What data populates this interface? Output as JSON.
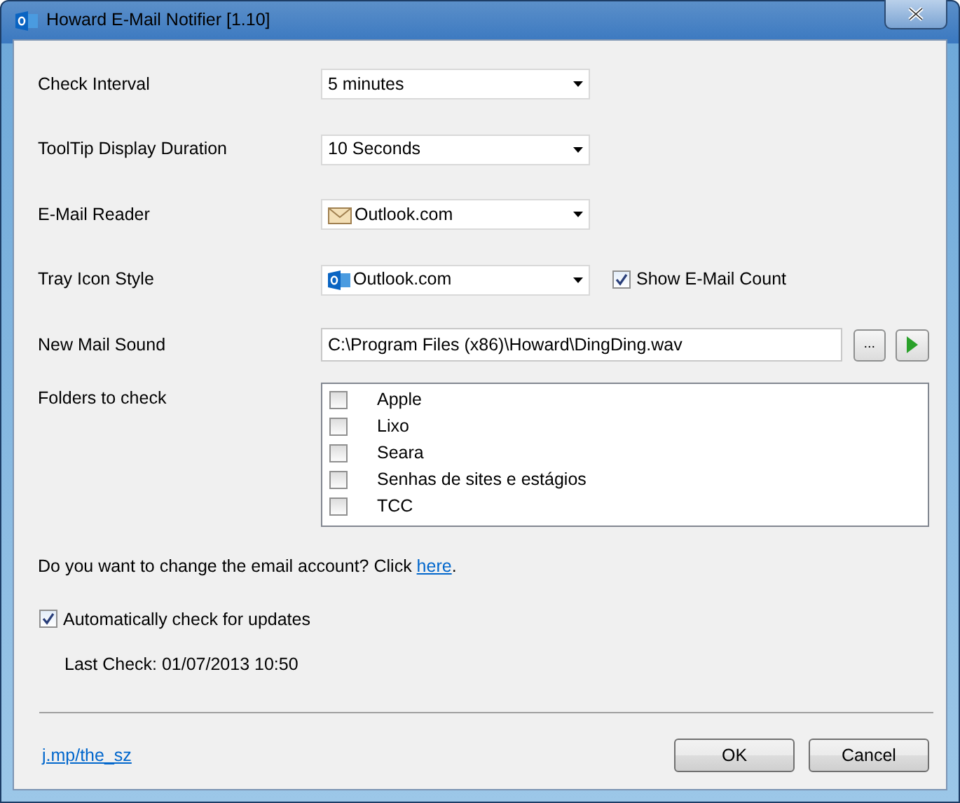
{
  "window": {
    "title": "Howard E-Mail Notifier [1.10]"
  },
  "settings": [
    {
      "kind": "dropdown",
      "label": "Check Interval",
      "value": "5 minutes"
    },
    {
      "kind": "dropdown",
      "label": "ToolTip Display Duration",
      "value": "10 Seconds"
    },
    {
      "kind": "dropdown",
      "label": "E-Mail Reader",
      "value": "Outlook.com"
    },
    {
      "kind": "dropdown",
      "label": "Tray Icon Style",
      "value": "Outlook.com",
      "checkbox": {
        "label": "Show E-Mail Count",
        "checked": true
      }
    },
    {
      "kind": "file",
      "label": "New Mail Sound",
      "value": "C:\\Program Files (x86)\\Howard\\DingDing.wav",
      "browse": "..."
    }
  ],
  "folders": {
    "label": "Folders to check",
    "items": [
      {
        "name": "Apple",
        "checked": false
      },
      {
        "name": "Lixo",
        "checked": false
      },
      {
        "name": "Seara",
        "checked": false
      },
      {
        "name": "Senhas de sites e estágios",
        "checked": false
      },
      {
        "name": "TCC",
        "checked": false
      }
    ]
  },
  "account_prompt": {
    "text": "Do you want to change the email account? Click ",
    "link": "here",
    "suffix": "."
  },
  "auto_update": {
    "label": "Automatically check for updates",
    "checked": true
  },
  "last_check": "Last Check: 01/07/2013 10:50",
  "footer_link": "j.mp/the_sz",
  "buttons": [
    "OK",
    "Cancel"
  ]
}
